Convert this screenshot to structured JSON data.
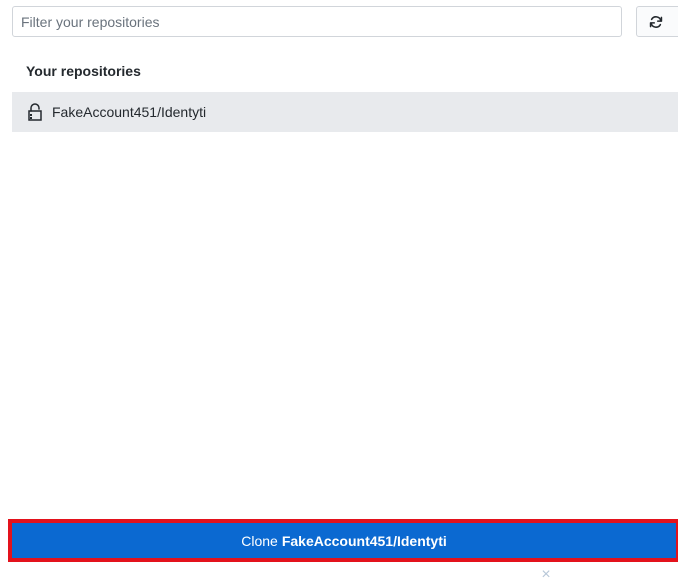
{
  "filter": {
    "placeholder": "Filter your repositories",
    "value": ""
  },
  "refresh": {
    "icon": "sync-icon"
  },
  "section": {
    "title": "Your repositories"
  },
  "repositories": [
    {
      "name": "FakeAccount451/Identyti",
      "icon": "lock-icon",
      "selected": true
    }
  ],
  "clone_button": {
    "prefix": "Clone",
    "repo": "FakeAccount451/Identyti"
  },
  "dismiss": {
    "icon": "close-icon",
    "glyph": "×"
  },
  "colors": {
    "selected_row": "#e8eaed",
    "primary_button": "#0b69d1",
    "highlight_outline": "#e3121c",
    "border": "#d1d5da",
    "text": "#24292e"
  }
}
